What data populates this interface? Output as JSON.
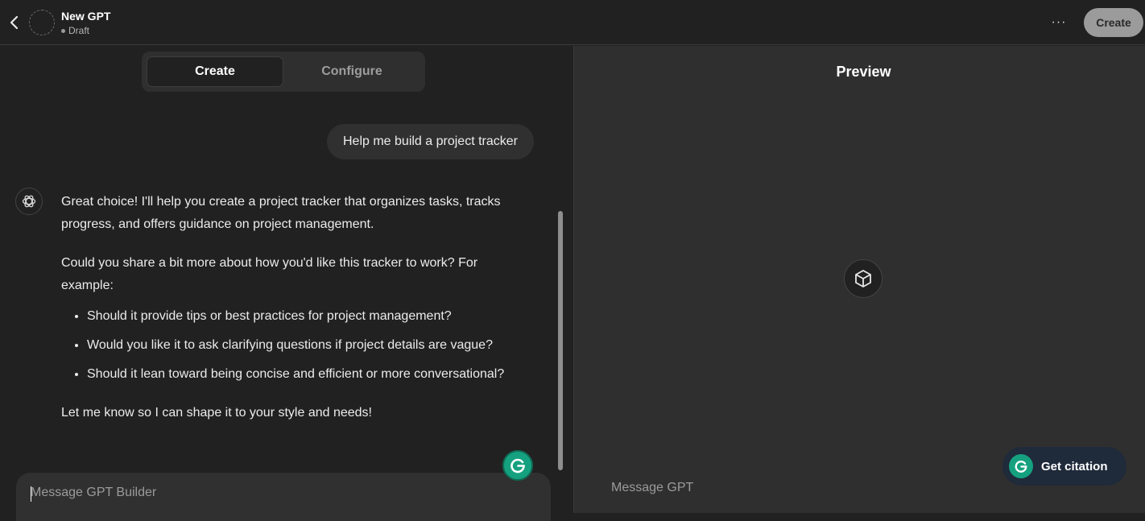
{
  "header": {
    "gpt_name": "New GPT",
    "status": "Draft",
    "more_label": "···",
    "create_button": "Create"
  },
  "builder": {
    "tabs": [
      {
        "label": "Create",
        "active": true
      },
      {
        "label": "Configure",
        "active": false
      }
    ],
    "user_message": "Help me build a project tracker",
    "assistant_message": {
      "paragraph1": "Great choice! I'll help you create a project tracker that organizes tasks, tracks progress, and offers guidance on project management.",
      "paragraph2": "Could you share a bit more about how you'd like this tracker to work? For example:",
      "bullets": [
        "Should it provide tips or best practices for project management?",
        "Would you like it to ask clarifying questions if project details are vague?",
        "Should it lean toward being concise and efficient or more conversational?"
      ],
      "closing": "Let me know so I can shape it to your style and needs!"
    },
    "input_placeholder": "Message GPT Builder"
  },
  "preview": {
    "title": "Preview",
    "input_placeholder": "Message GPT",
    "citation_button": "Get citation"
  },
  "icons": {
    "back": "chevron-left-icon",
    "assistant": "openai-logo-icon",
    "preview": "cube-icon",
    "grammarly": "grammarly-icon"
  },
  "colors": {
    "background": "#212121",
    "preview_background": "#2f2f2f",
    "create_button": "#9b9b9b",
    "grammarly": "#15a180",
    "citation_button": "#1f2a3a"
  }
}
